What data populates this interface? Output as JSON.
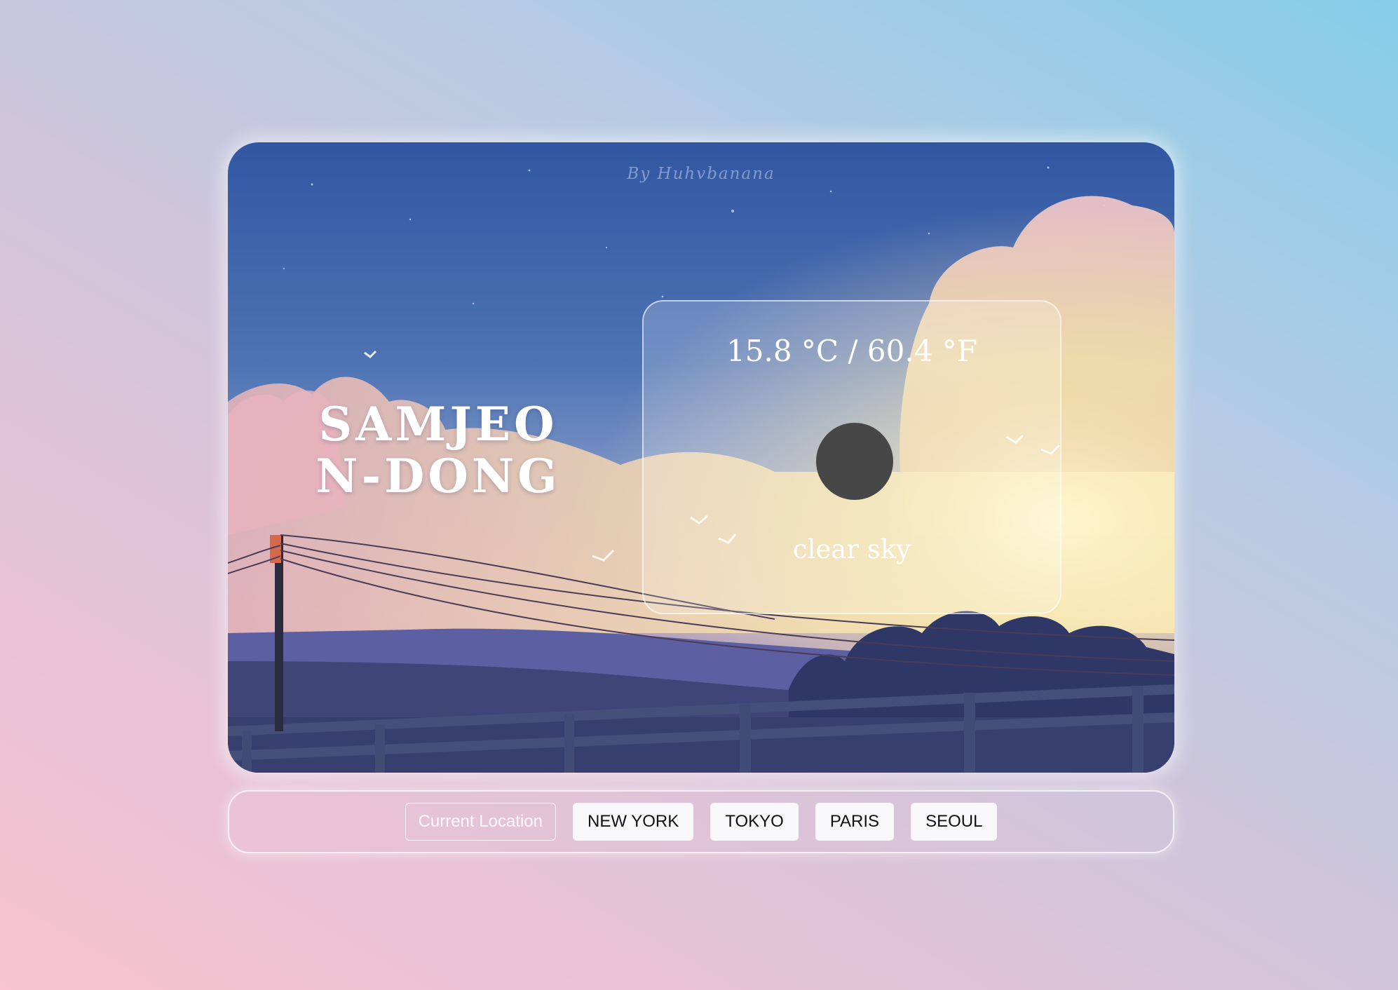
{
  "card": {
    "watermark": "By Huhvbanana",
    "city": "SAMJEON-DONG",
    "temperature": "15.8 °C / 60.4 °F",
    "icon": "weather-icon",
    "description": "clear sky"
  },
  "nav": {
    "buttons": [
      "Current Location",
      "NEW YORK",
      "TOKYO",
      "PARIS",
      "SEOUL"
    ]
  },
  "colors": {
    "sky_top": "#3257a2",
    "sky_mid": "#5a82bd",
    "cloud_pink": "#e9b7c0",
    "cloud_yellow": "#f3e6a8",
    "hill": "#5d5fa3",
    "ground": "#363f6e",
    "icon_fill": "#474747"
  }
}
